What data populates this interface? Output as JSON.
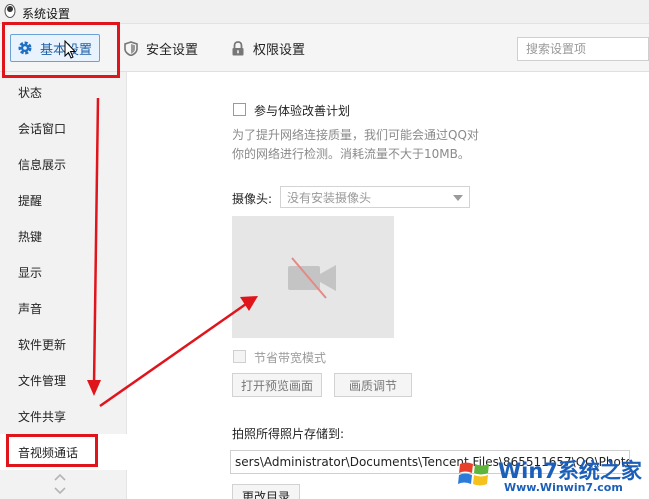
{
  "window": {
    "title": "系统设置"
  },
  "toolbar": {
    "basic_label": "基本设置",
    "security_label": "安全设置",
    "permission_label": "权限设置",
    "search_placeholder": "搜索设置项"
  },
  "sidebar": {
    "items": [
      {
        "label": "状态"
      },
      {
        "label": "会话窗口"
      },
      {
        "label": "信息展示"
      },
      {
        "label": "提醒"
      },
      {
        "label": "热键"
      },
      {
        "label": "显示"
      },
      {
        "label": "声音"
      },
      {
        "label": "软件更新"
      },
      {
        "label": "文件管理"
      },
      {
        "label": "文件共享"
      },
      {
        "label": "音视频通话"
      }
    ]
  },
  "main": {
    "experience_plan_label": "参与体验改善计划",
    "experience_desc": "为了提升网络连接质量，我们可能会通过QQ对你的网络进行检测。消耗流量不大于10MB。",
    "camera_label": "摄像头:",
    "camera_selected": "没有安装摄像头",
    "bandwidth_label": "节省带宽模式",
    "open_preview_label": "打开预览画面",
    "quality_label": "画质调节",
    "photo_save_label": "拍照所得照片存储到:",
    "photo_path": "sers\\Administrator\\Documents\\Tencent Files\\865511657\\QQ\\Photo",
    "change_dir_label": "更改目录"
  },
  "watermark": {
    "brand": "Win7系统之家",
    "url": "Www.Winwin7.com"
  },
  "colors": {
    "annotation_red": "#e0141b",
    "accent_blue": "#1f5fa6"
  }
}
